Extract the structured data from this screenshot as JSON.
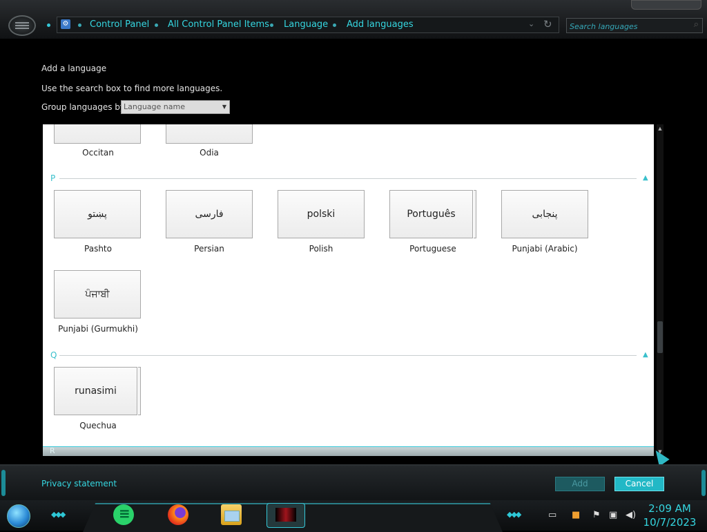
{
  "address_bar": {
    "crumbs": [
      "Control Panel",
      "All Control Panel Items",
      "Language",
      "Add languages"
    ]
  },
  "search": {
    "placeholder": "Search languages"
  },
  "content": {
    "title": "Add a language",
    "instruction": "Use the search box to find more languages.",
    "group_by_label": "Group languages by:",
    "group_by_value": "Language name",
    "top_partial": [
      {
        "native": "",
        "name": "Occitan"
      },
      {
        "native": "",
        "name": "Odia"
      }
    ],
    "groups": [
      {
        "letter": "P",
        "languages": [
          {
            "native": "پښتو",
            "name": "Pashto"
          },
          {
            "native": "فارسی",
            "name": "Persian"
          },
          {
            "native": "polski",
            "name": "Polish"
          },
          {
            "native": "Português",
            "name": "Portuguese"
          },
          {
            "native": "پنجابی",
            "name": "Punjabi (Arabic)"
          },
          {
            "native": "ਪੰਜਾਬੀ",
            "name": "Punjabi (Gurmukhi)"
          }
        ]
      },
      {
        "letter": "Q",
        "languages": [
          {
            "native": "runasimi",
            "name": "Quechua"
          }
        ]
      },
      {
        "letter": "R",
        "languages": []
      }
    ]
  },
  "footer": {
    "privacy": "Privacy statement",
    "add": "Add",
    "cancel": "Cancel"
  },
  "taskbar": {
    "time": "2:09 AM",
    "date": "10/7/2023"
  }
}
